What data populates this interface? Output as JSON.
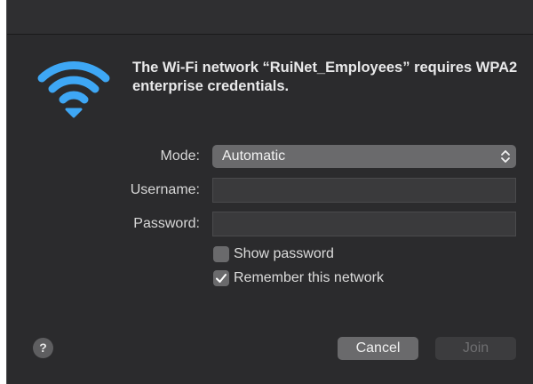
{
  "dialog": {
    "message": "The Wi-Fi network “RuiNet_Employees” requires WPA2 enterprise credentials.",
    "icon": "wifi-icon",
    "accent_color": "#3ea7f5"
  },
  "form": {
    "mode_label": "Mode:",
    "mode_value": "Automatic",
    "username_label": "Username:",
    "username_value": "",
    "password_label": "Password:",
    "password_value": ""
  },
  "options": {
    "show_password_label": "Show password",
    "show_password_checked": false,
    "remember_label": "Remember this network",
    "remember_checked": true
  },
  "buttons": {
    "help": "?",
    "cancel": "Cancel",
    "join": "Join"
  }
}
